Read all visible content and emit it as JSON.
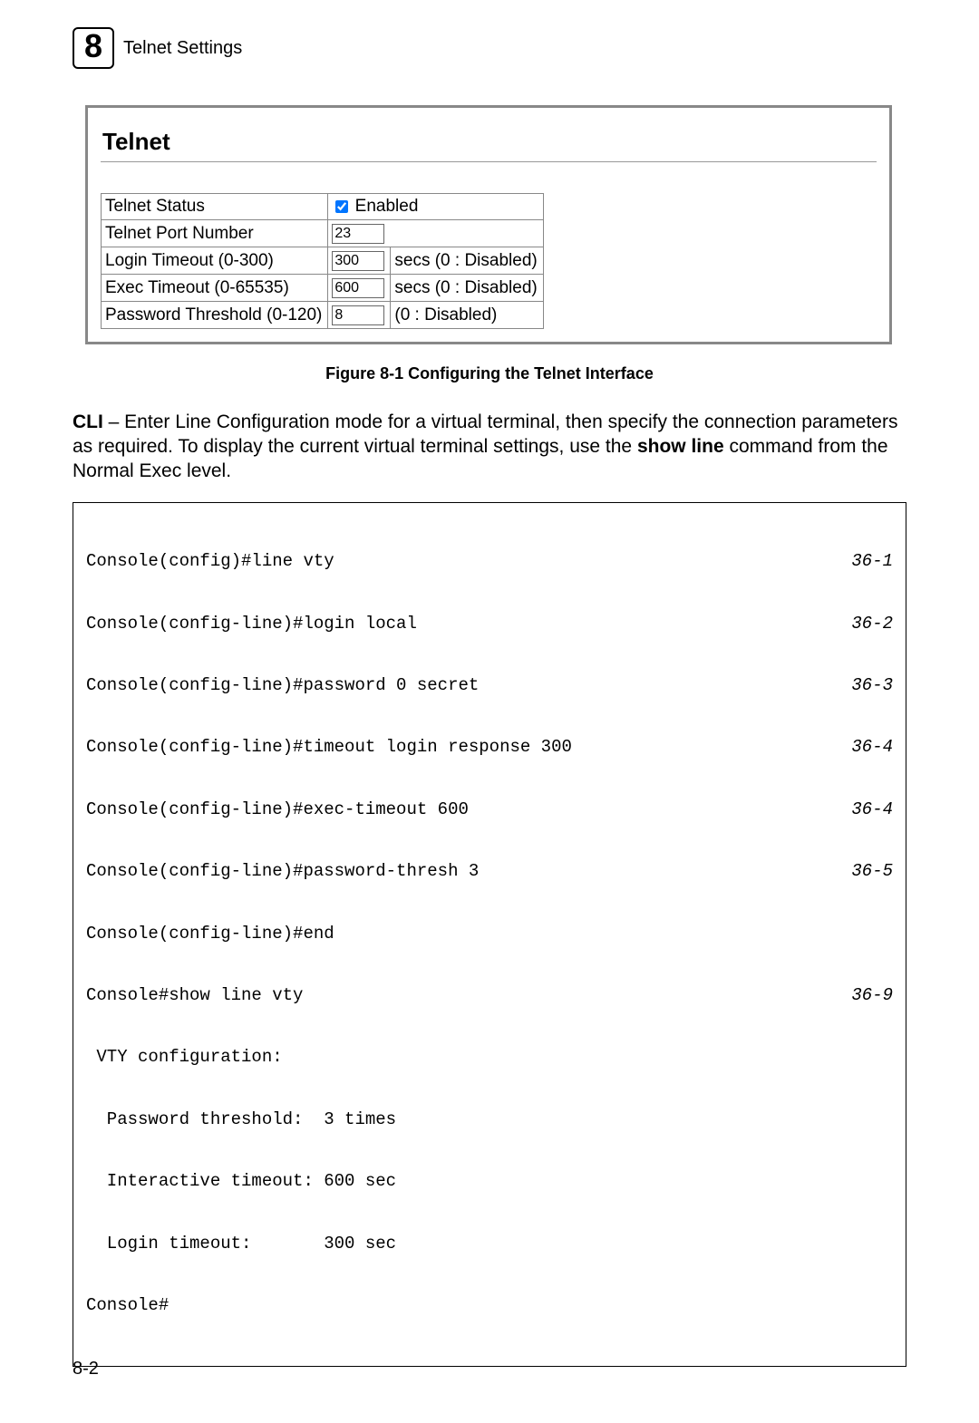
{
  "header": {
    "chapter_number": "8",
    "section_title": "Telnet Settings"
  },
  "screenshot": {
    "panel_title": "Telnet",
    "rows": [
      {
        "label": "Telnet Status",
        "checkbox_checked": true,
        "checkbox_label": "Enabled",
        "value": null,
        "suffix": null
      },
      {
        "label": "Telnet Port Number",
        "value": "23",
        "suffix": null
      },
      {
        "label": "Login Timeout (0-300)",
        "value": "300",
        "suffix": "secs (0 : Disabled)"
      },
      {
        "label": "Exec Timeout (0-65535)",
        "value": "600",
        "suffix": "secs (0 : Disabled)"
      },
      {
        "label": "Password Threshold (0-120)",
        "value": "8",
        "suffix": "(0 : Disabled)"
      }
    ]
  },
  "figure_caption": "Figure 8-1  Configuring the Telnet Interface",
  "cli_intro": {
    "lead_bold": "CLI",
    "text_1": " – Enter Line Configuration mode for a virtual terminal, then specify the connection parameters as required. To display the current virtual terminal settings, use the ",
    "show_line_bold": "show line",
    "text_2": " command from the Normal Exec level."
  },
  "cli_block": {
    "lines": [
      {
        "text": "Console(config)#line vty",
        "ref": "36-1"
      },
      {
        "text": "Console(config-line)#login local",
        "ref": "36-2"
      },
      {
        "text": "Console(config-line)#password 0 secret",
        "ref": "36-3"
      },
      {
        "text": "Console(config-line)#timeout login response 300",
        "ref": "36-4"
      },
      {
        "text": "Console(config-line)#exec-timeout 600",
        "ref": "36-4"
      },
      {
        "text": "Console(config-line)#password-thresh 3",
        "ref": "36-5"
      },
      {
        "text": "Console(config-line)#end",
        "ref": ""
      },
      {
        "text": "Console#show line vty",
        "ref": "36-9"
      },
      {
        "text": " VTY configuration:",
        "ref": ""
      },
      {
        "text": "  Password threshold:  3 times",
        "ref": ""
      },
      {
        "text": "  Interactive timeout: 600 sec",
        "ref": ""
      },
      {
        "text": "  Login timeout:       300 sec",
        "ref": ""
      },
      {
        "text": "Console#",
        "ref": ""
      }
    ]
  },
  "page_number": "8-2"
}
